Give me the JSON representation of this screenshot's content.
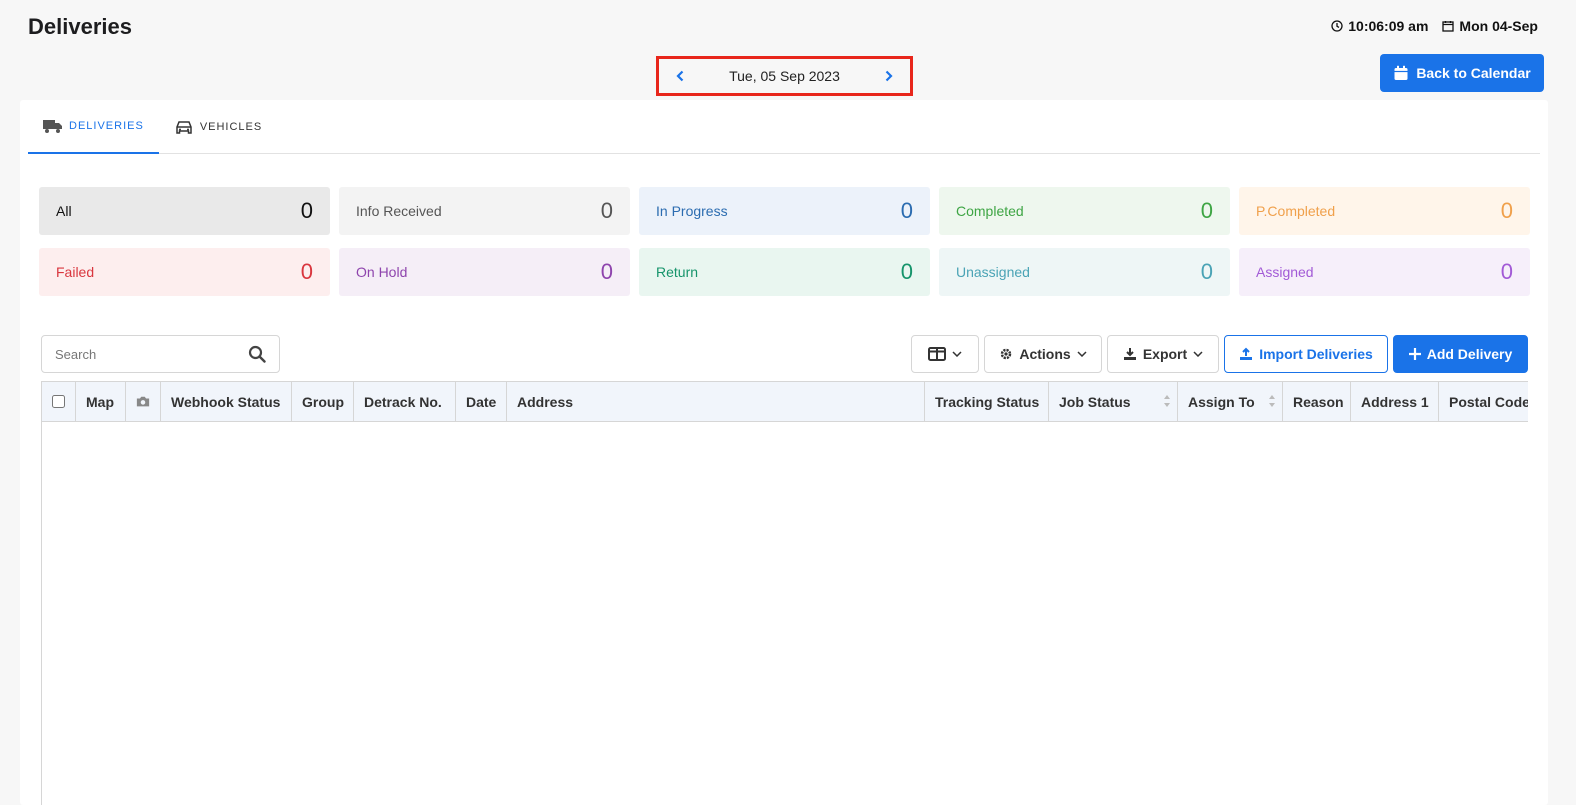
{
  "header": {
    "title": "Deliveries",
    "time": "10:06:09 am",
    "date": "Mon 04-Sep"
  },
  "date_nav": {
    "label": "Tue, 05 Sep 2023"
  },
  "back_to_calendar": "Back to Calendar",
  "tabs": [
    {
      "label": "DELIVERIES",
      "active": true
    },
    {
      "label": "VEHICLES",
      "active": false
    }
  ],
  "statuses": [
    {
      "label": "All",
      "count": "0",
      "bg": "#e9e9e9",
      "color": "#111111"
    },
    {
      "label": "Info Received",
      "count": "0",
      "bg": "#f3f3f3",
      "color": "#555555"
    },
    {
      "label": "In Progress",
      "count": "0",
      "bg": "#ecf2fa",
      "color": "#2b6cb0"
    },
    {
      "label": "Completed",
      "count": "0",
      "bg": "#eef7ee",
      "color": "#3ea544"
    },
    {
      "label": "P.Completed",
      "count": "0",
      "bg": "#fff5ea",
      "color": "#f0a04b"
    },
    {
      "label": "Failed",
      "count": "0",
      "bg": "#fdeeee",
      "color": "#d9363e"
    },
    {
      "label": "On Hold",
      "count": "0",
      "bg": "#f5eef7",
      "color": "#8e44ad"
    },
    {
      "label": "Return",
      "count": "0",
      "bg": "#e9f6f0",
      "color": "#16946b"
    },
    {
      "label": "Unassigned",
      "count": "0",
      "bg": "#eef6f6",
      "color": "#4aa3b5"
    },
    {
      "label": "Assigned",
      "count": "0",
      "bg": "#f6effa",
      "color": "#a25ad6"
    }
  ],
  "search": {
    "placeholder": "Search"
  },
  "toolbar": {
    "actions_label": "Actions",
    "export_label": "Export",
    "import_label": "Import Deliveries",
    "add_label": "Add Delivery"
  },
  "table": {
    "columns": [
      "Map",
      "Webhook Status",
      "Group",
      "Detrack No.",
      "Date",
      "Address",
      "Tracking Status",
      "Job Status",
      "Assign To",
      "Reason",
      "Address 1",
      "Postal Code"
    ]
  }
}
